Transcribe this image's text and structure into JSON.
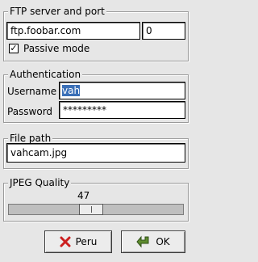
{
  "ftp": {
    "title": "FTP server and port",
    "server": "ftp.foobar.com",
    "port": "0",
    "passive_label": "Passive mode",
    "passive_checked": true
  },
  "auth": {
    "title": "Authentication",
    "username_label": "Username",
    "username_value": "vah",
    "password_label": "Password",
    "password_value": "*********"
  },
  "file": {
    "title": "File path",
    "path": "vahcam.jpg"
  },
  "jpeg": {
    "title": "JPEG Quality",
    "value": "47",
    "fraction": 0.47
  },
  "buttons": {
    "cancel": "Peru",
    "ok": "OK"
  },
  "colors": {
    "selection": "#3a6fb7",
    "cancel_icon": "#cc1f1f",
    "ok_icon": "#5e8c2e"
  }
}
